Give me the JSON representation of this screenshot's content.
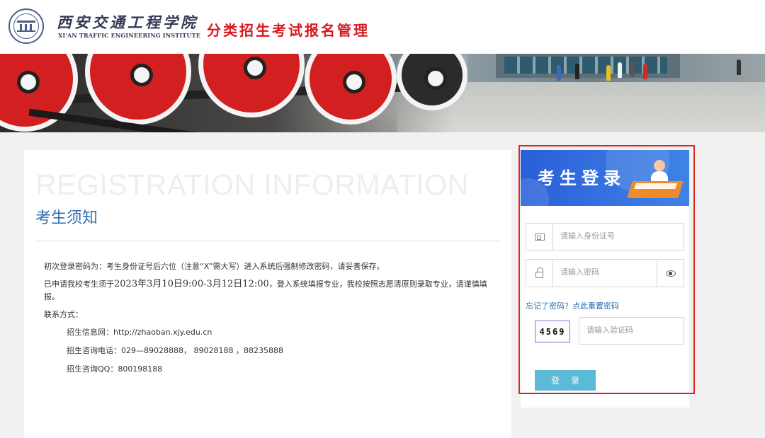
{
  "header": {
    "school_name_cn": "西安交通工程学院",
    "school_name_en": "XI'AN TRAFFIC ENGINEERING INSTITUTE",
    "system_title": "分类招生考试报名管理"
  },
  "notice": {
    "ghost_title": "REGISTRATION INFORMATION",
    "title": "考生须知",
    "line1": "初次登录密码为：考生身份证号后六位（注意“X”需大写）进入系统后强制修改密码，请妥善保存。",
    "line2_prefix": "已申请我校考生须于",
    "line2_dates": "2023年3月10日9:00-3月12日12:00",
    "line2_suffix": "，登入系统填报专业，我校按照志愿清原则录取专业，请谨慎填报。",
    "contact_label": "联系方式：",
    "contact_web": "招生信息网：http://zhaoban.xjy.edu.cn",
    "contact_phone": "招生咨询电话：029—89028888， 89028188 ，88235888",
    "contact_qq": "招生咨询QQ：800198188"
  },
  "login": {
    "banner_title": "考生登录",
    "id_placeholder": "请输入身份证号",
    "password_placeholder": "请输入密码",
    "forgot_text": "忘记了密码？点此重置密码",
    "captcha_text": "4569",
    "captcha_placeholder": "请输入验证码",
    "submit_label": "登 录"
  },
  "colors": {
    "brand_red": "#d9171e",
    "link_blue": "#2e6fb2",
    "button_blue": "#5bbad5",
    "highlight_red": "#e0241e"
  },
  "icons": [
    "school-logo",
    "id-card-icon",
    "lock-icon",
    "eye-icon"
  ]
}
